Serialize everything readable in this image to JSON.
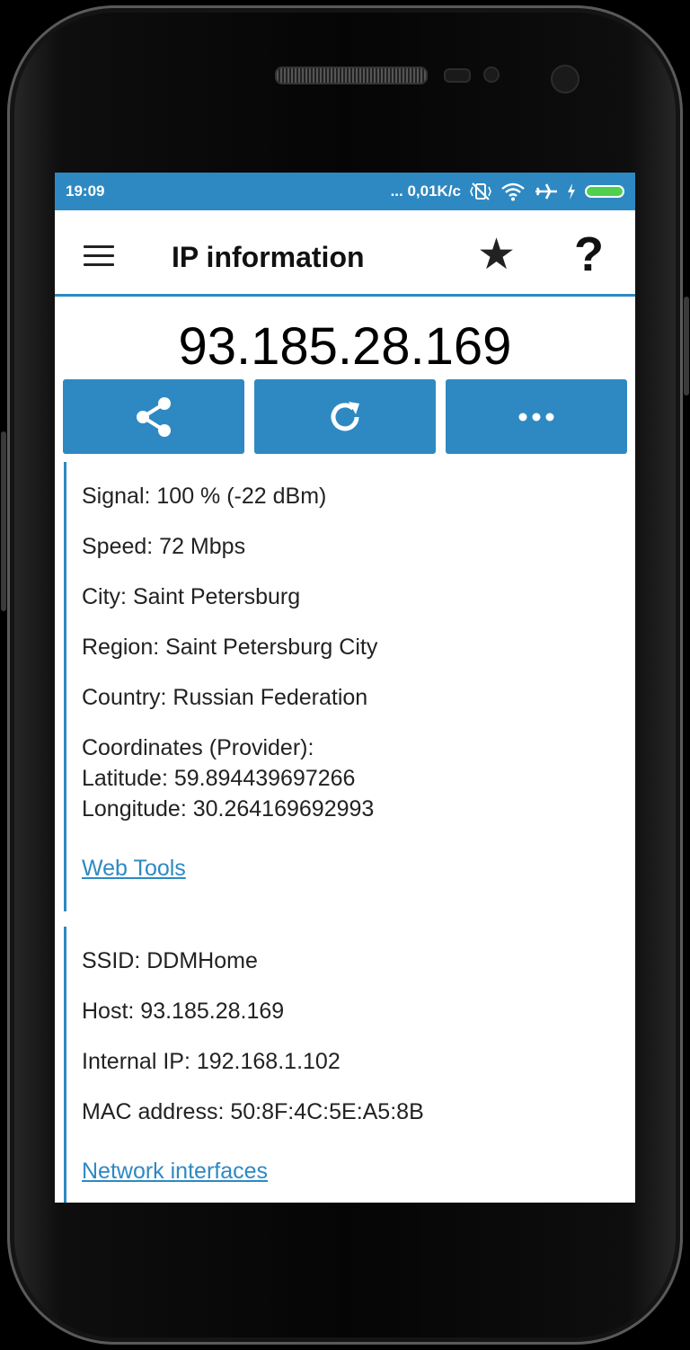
{
  "status": {
    "time": "19:09",
    "net_speed": "... 0,01K/c"
  },
  "appbar": {
    "title": "IP information",
    "menu_icon": "menu-icon",
    "favorite_icon": "star-icon",
    "help_icon": "help-icon",
    "help_glyph": "?"
  },
  "ip_address": "93.185.28.169",
  "actions": [
    {
      "icon": "share-icon"
    },
    {
      "icon": "refresh-icon"
    },
    {
      "icon": "more-icon"
    }
  ],
  "location": {
    "signal": "Signal: 100 % (-22 dBm)",
    "speed": "Speed: 72 Mbps",
    "city": "City: Saint Petersburg",
    "region": "Region: Saint Petersburg City",
    "country": "Country: Russian Federation",
    "coords_header": "Coordinates (Provider):",
    "latitude": "Latitude: 59.894439697266",
    "longitude": "Longitude: 30.264169692993",
    "link": "Web Tools"
  },
  "network": {
    "ssid": "SSID: DDMHome",
    "host": "Host: 93.185.28.169",
    "internal_ip": "Internal IP: 192.168.1.102",
    "mac": "MAC address: 50:8F:4C:5E:A5:8B",
    "link": "Network interfaces"
  },
  "colors": {
    "accent": "#2e89c2",
    "battery": "#4fd04f"
  }
}
